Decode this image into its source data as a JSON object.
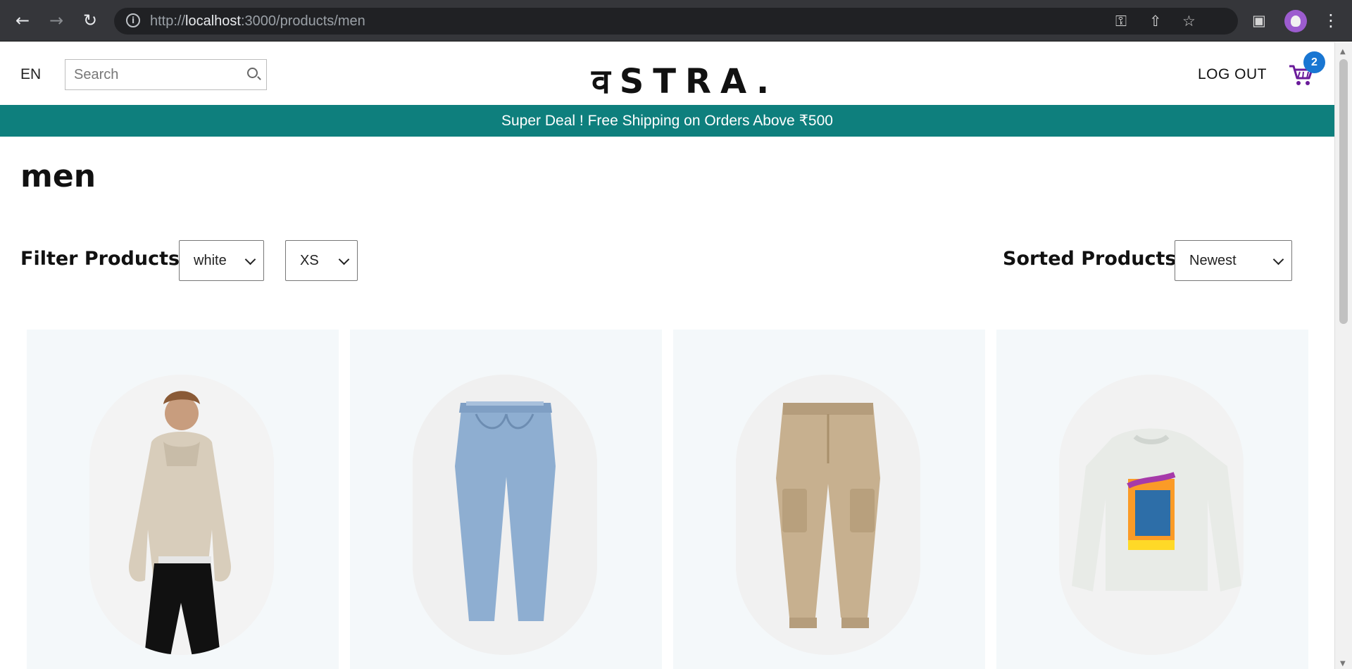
{
  "browser": {
    "url_prefix": "http://",
    "url_host": "localhost",
    "url_path": ":3000/products/men"
  },
  "header": {
    "language": "EN",
    "search_placeholder": "Search",
    "logo": "वSTRA.",
    "logout": "LOG OUT",
    "cart_count": "2"
  },
  "announcement": "Super Deal ! Free Shipping on Orders Above ₹500",
  "page": {
    "title": "men",
    "filter_label": "Filter Products:",
    "color_filter": "white",
    "size_filter": "XS",
    "sort_label": "Sorted Products",
    "sort_value": "Newest"
  },
  "products": [
    {
      "icon": "hoodie-model-image"
    },
    {
      "icon": "blue-jeans-image"
    },
    {
      "icon": "cargo-pants-image"
    },
    {
      "icon": "sweatshirt-image"
    }
  ],
  "colors": {
    "accent": "#0e7f7d",
    "badge": "#1976d2",
    "cart": "#6a1b9a"
  }
}
